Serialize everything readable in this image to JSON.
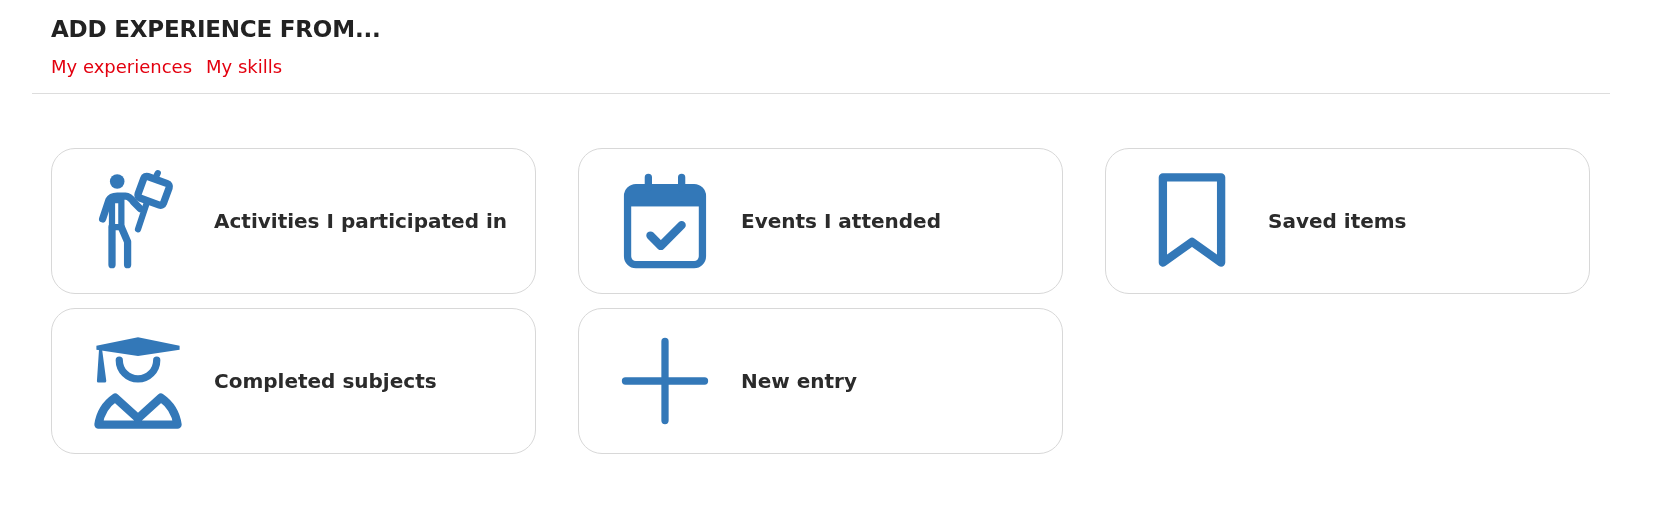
{
  "header": {
    "title": "ADD EXPERIENCE FROM...",
    "links": [
      "My experiences",
      "My skills"
    ]
  },
  "cards": [
    {
      "kind": "activity",
      "label": "Activities I participated in"
    },
    {
      "kind": "calendar",
      "label": "Events I attended"
    },
    {
      "kind": "bookmark",
      "label": "Saved items"
    },
    {
      "kind": "graduate",
      "label": "Completed subjects"
    },
    {
      "kind": "plus",
      "label": "New entry"
    }
  ]
}
